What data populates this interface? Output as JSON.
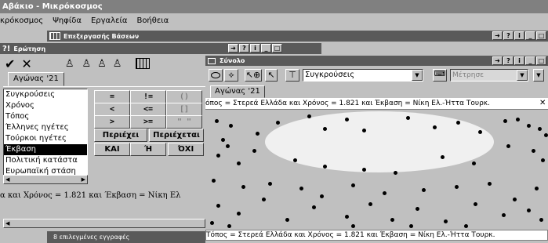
{
  "app": {
    "title": "Αβάκιο - Μικρόκοσμος",
    "menu": [
      "κρόκοσμος",
      "Ψηφίδα",
      "Εργαλεία",
      "Βοήθεια"
    ]
  },
  "db_window": {
    "title": "Επεξεργασής Βάσεων"
  },
  "query_window": {
    "title": "Ερώτηση",
    "tab": "Αγώνας '21",
    "operators": [
      {
        "label": "=",
        "enabled": true
      },
      {
        "label": "!=",
        "enabled": true
      },
      {
        "label": "()",
        "enabled": false
      },
      {
        "label": "<",
        "enabled": true
      },
      {
        "label": "<=",
        "enabled": true
      },
      {
        "label": "[]",
        "enabled": false
      },
      {
        "label": ">",
        "enabled": true
      },
      {
        "label": ">=",
        "enabled": true
      },
      {
        "label": "\" \"",
        "enabled": false
      }
    ],
    "contains_label": "Περιέχει",
    "contained_label": "Περιέχεται",
    "and_label": "ΚΑΙ",
    "or_label": "Ή",
    "not_label": "ΌΧΙ",
    "fields": [
      "Συγκρούσεις",
      "Χρόνος",
      "Τόπος",
      "Έλληνες ηγέτες",
      "Τούρκοι ηγέτες",
      "Έκβαση",
      "Πολιτική κατάστα",
      "Ευρωπαϊκή στάση"
    ],
    "selected_field": "Έκβαση",
    "query_text": "α και Χρόνος = 1.821 και Έκβαση = Νίκη Ελ",
    "status": "8 επιλεγμένες εγγραφές"
  },
  "set_window": {
    "title": "Σύνολο",
    "dropdown_value": "Συγκρούσεις",
    "measure_placeholder": "Μέτρησε",
    "tab": "Αγώνας '21",
    "condition": "όπος = Στερεά Ελλάδα και Χρόνος = 1.821 και Έκβαση = Νίκη Ελ.-Ήττα Τουρκ.",
    "status": "Τόπος = Στερεά Ελλάδα και Χρόνος = 1.821 και Έκβαση = Νίκη Ελ.-Ήττα Τουρκ."
  },
  "colors": {
    "title_bar": "#5a5a5a",
    "face": "#c0c0c0",
    "set_region": "#f0f0f0"
  }
}
